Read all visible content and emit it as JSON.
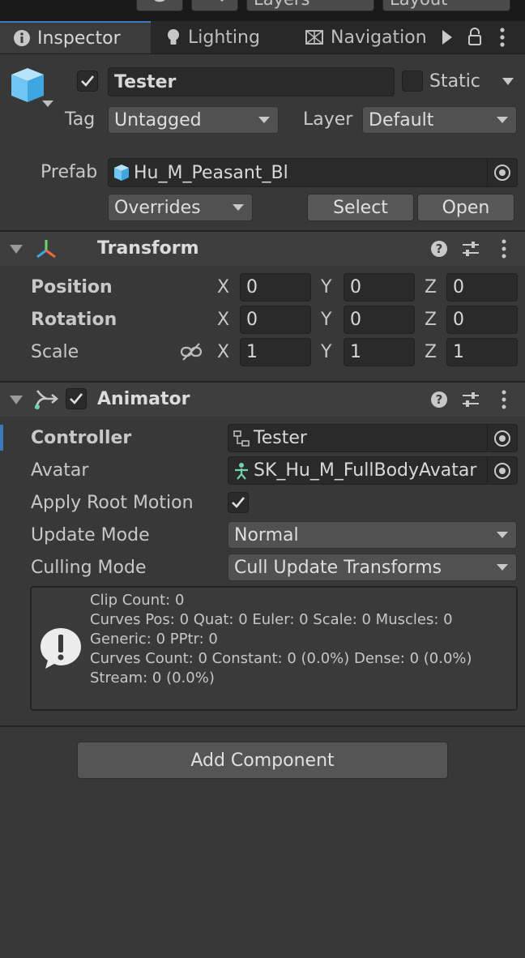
{
  "tabs": [
    {
      "label": "Inspector",
      "icon": "info-icon"
    },
    {
      "label": "Lighting",
      "icon": "bulb-icon"
    },
    {
      "label": "Navigation",
      "icon": "navmesh-icon"
    }
  ],
  "topbar": {
    "layers_label": "Layers",
    "layout_label": "Layout"
  },
  "gameobject": {
    "active": true,
    "name": "Tester",
    "static_label": "Static",
    "static_checked": false,
    "tag_label": "Tag",
    "tag_value": "Untagged",
    "layer_label": "Layer",
    "layer_value": "Default",
    "prefab_label": "Prefab",
    "prefab_value": "Hu_M_Peasant_Bl",
    "overrides_label": "Overrides",
    "select_label": "Select",
    "open_label": "Open"
  },
  "transform": {
    "title": "Transform",
    "rows": [
      {
        "label": "Position",
        "x": "0",
        "y": "0",
        "z": "0"
      },
      {
        "label": "Rotation",
        "x": "0",
        "y": "0",
        "z": "0"
      },
      {
        "label": "Scale",
        "x": "1",
        "y": "1",
        "z": "1"
      }
    ],
    "axis": {
      "x": "X",
      "y": "Y",
      "z": "Z"
    }
  },
  "animator": {
    "title": "Animator",
    "enabled": true,
    "controller_label": "Controller",
    "controller_value": "Tester",
    "avatar_label": "Avatar",
    "avatar_value": "SK_Hu_M_FullBodyAvatar",
    "apply_root_motion_label": "Apply Root Motion",
    "apply_root_motion": true,
    "update_mode_label": "Update Mode",
    "update_mode_value": "Normal",
    "culling_mode_label": "Culling Mode",
    "culling_mode_value": "Cull Update Transforms",
    "info_lines": [
      "Clip Count: 0",
      "Curves Pos: 0 Quat: 0 Euler: 0 Scale: 0 Muscles: 0",
      "Generic: 0 PPtr: 0",
      "Curves Count: 0 Constant: 0 (0.0%) Dense: 0 (0.0%)",
      "Stream: 0 (0.0%)"
    ]
  },
  "add_component_label": "Add Component",
  "colors": {
    "accent": "#3a79bb",
    "background": "#383838",
    "field": "#2a2a2a"
  }
}
